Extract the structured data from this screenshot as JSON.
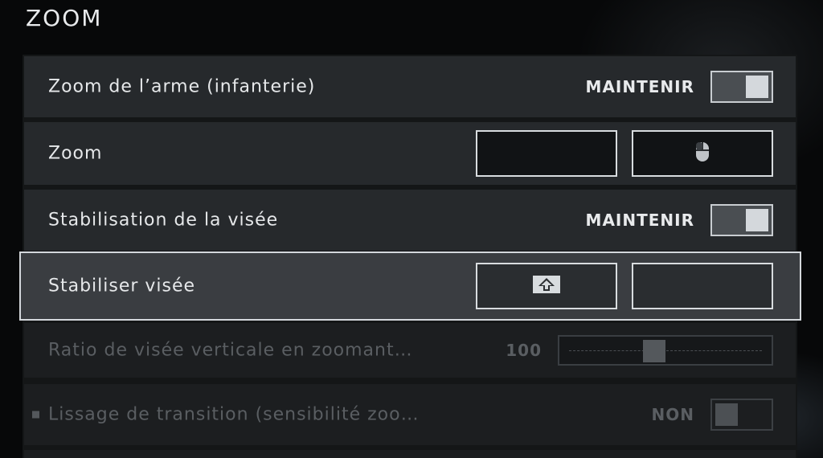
{
  "section": {
    "title": "ZOOM"
  },
  "rows": [
    {
      "label": "Zoom de l’arme (infanterie)",
      "value": "MAINTENIR",
      "toggle_on": true
    },
    {
      "label": "Zoom",
      "primary_key": "",
      "secondary_key_icon": "mouse-icon"
    },
    {
      "label": "Stabilisation de la visée",
      "value": "MAINTENIR",
      "toggle_on": true
    },
    {
      "label": "Stabiliser visée",
      "primary_key_icon": "shift-key-icon",
      "secondary_key": ""
    },
    {
      "label": "Ratio de visée verticale en zoomant…",
      "value": "100",
      "slider_fraction": 0.44
    },
    {
      "label": "Lissage de transition (sensibilité zoo…",
      "value": "NON",
      "toggle_on": false
    }
  ],
  "colors": {
    "row_bg": "#26292c",
    "selected_bg": "#3a3d41",
    "text": "#e6e8ea",
    "disabled_text": "#5a5e62"
  }
}
